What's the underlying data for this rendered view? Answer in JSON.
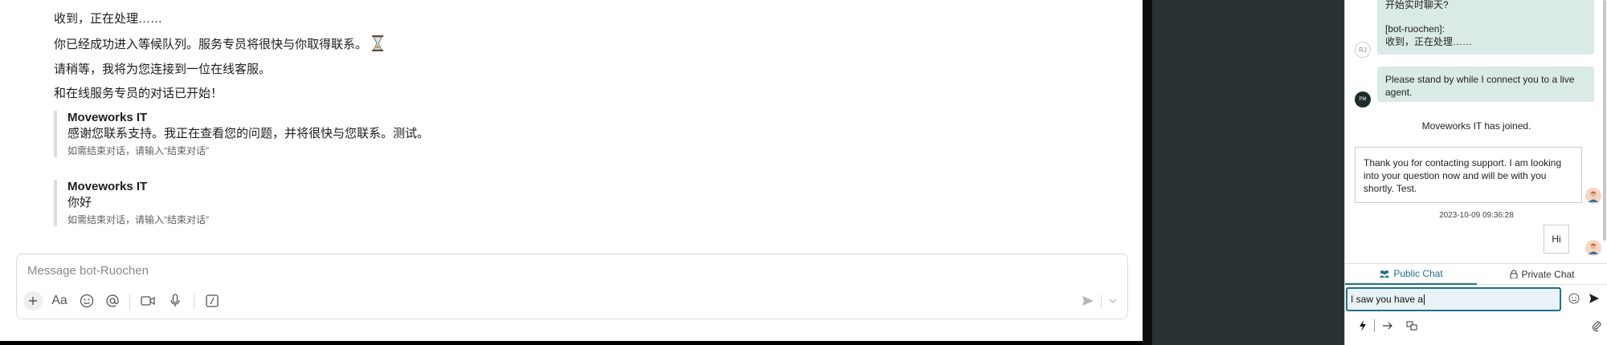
{
  "left": {
    "messages": [
      "收到，正在处理……",
      "你已经成功进入等候队列。服务专员将很快与你取得联系。",
      "请稍等，我将为您连接到一位在线客服。",
      "和在线服务专员的对话已开始！"
    ],
    "quotes": [
      {
        "title": "Moveworks IT",
        "body": "感谢您联系支持。我正在查看您的问题，并将很快与您联系。测试。",
        "footer": "如需结束对话，请输入“结束对话”"
      },
      {
        "title": "Moveworks IT",
        "body": "你好",
        "footer": "如需结束对话，请输入“结束对话”"
      }
    ],
    "composer": {
      "placeholder": "Message bot-Ruochen",
      "format_label": "Aa"
    }
  },
  "widget": {
    "top_bubble": {
      "line1": "开始实时聊天?",
      "line2": "[bot-ruochen]:",
      "line3": "收到，正在处理……",
      "avatar": "RJ"
    },
    "standby": {
      "text": "Please stand by while I connect you to a live agent.",
      "avatar": "PM"
    },
    "joined": "Moveworks IT has joined.",
    "agent_msg": "Thank you for contacting support. I am looking into your question now and will be with you shortly. Test.",
    "timestamp": "2023-10-09 09:36:28",
    "hi": "Hi",
    "tabs": {
      "public": "Public Chat",
      "private": "Private Chat"
    },
    "input_value": "I saw you have a",
    "colors": {
      "bubble": "#daeae6",
      "tab_active": "#1f6f8b"
    }
  }
}
